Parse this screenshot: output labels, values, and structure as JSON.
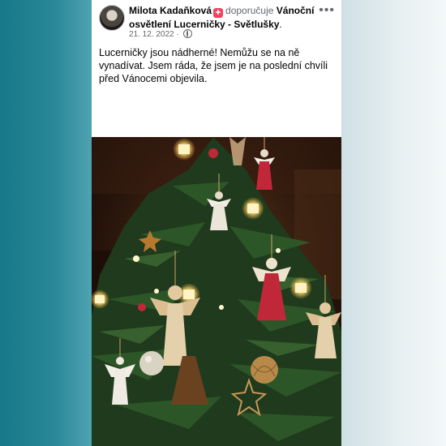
{
  "post": {
    "author": "Milota Kadaňková",
    "action": "doporučuje",
    "page": "Vánoční osvětlení Lucerničky - Světlušky",
    "date": "21. 12. 2022",
    "date_separator": "·",
    "more_label": "•••",
    "text": "Lucerničky jsou nádherné! Nemůžu se na ně vynadívat. Jsem ráda, že jsem je na poslední chvíli před Vánocemi objevila."
  },
  "icons": {
    "badge": "recommend-badge-icon",
    "privacy": "globe-icon",
    "more": "more-options-icon"
  },
  "colors": {
    "card": "#ffffff",
    "text": "#050505",
    "muted": "#65676b",
    "badge": "#f3425f"
  }
}
